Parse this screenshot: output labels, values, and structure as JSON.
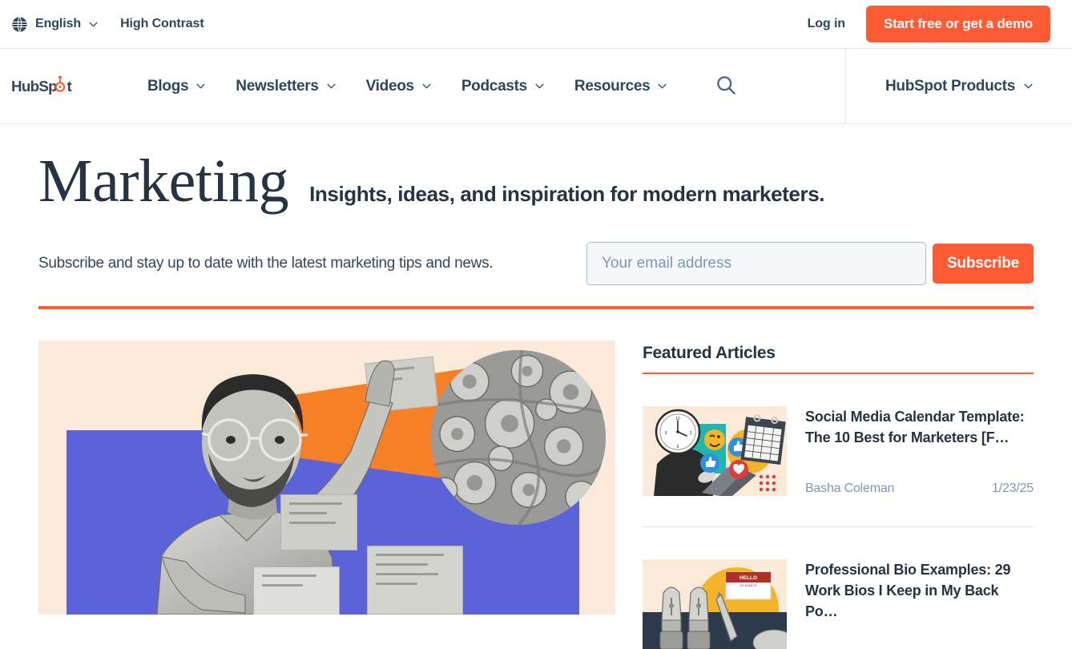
{
  "utility_bar": {
    "language": {
      "label": "English",
      "icon": "globe-icon",
      "chevron": "chevron-down-icon"
    },
    "high_contrast_label": "High Contrast",
    "login_label": "Log in",
    "cta_label": "Start free or get a demo"
  },
  "nav": {
    "logo_text": "HubSpot",
    "items": [
      {
        "label": "Blogs"
      },
      {
        "label": "Newsletters"
      },
      {
        "label": "Videos"
      },
      {
        "label": "Podcasts"
      },
      {
        "label": "Resources"
      }
    ],
    "search_icon": "search-icon",
    "products_label": "HubSpot Products"
  },
  "hero": {
    "title": "Marketing",
    "tagline": "Insights, ideas, and inspiration for modern marketers.",
    "subscribe_copy": "Subscribe and stay up to date with the latest marketing tips and news.",
    "email_placeholder": "Your email address",
    "email_value": "",
    "subscribe_button": "Subscribe"
  },
  "featured": {
    "heading": "Featured Articles",
    "articles": [
      {
        "title": "Social Media Calendar Template: The 10 Best for Marketers [F…",
        "author": "Basha Coleman",
        "date": "1/23/25",
        "thumbnail": "clock-head-person-laptop-collage"
      },
      {
        "title": "Professional Bio Examples: 29 Work Bios I Keep in My Back Po…",
        "author": "",
        "date": "",
        "thumbnail": "pen-nibs-hello-nametag-collage"
      }
    ]
  },
  "colors": {
    "accent_orange": "#ff5c35",
    "text_dark": "#253342",
    "text_body": "#33475b",
    "meta_gray": "#7c98b6",
    "cream": "#fbeada",
    "purple": "#5c62d8",
    "collage_orange": "#f58026",
    "border": "#e5eaef"
  }
}
